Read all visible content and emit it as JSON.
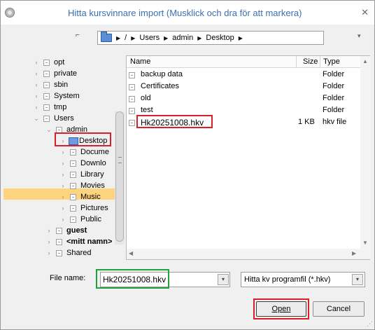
{
  "window": {
    "title": "Hitta kursvinnare import  (Musklick och dra för att markera)"
  },
  "path": {
    "crumbs": [
      "/",
      "Users",
      "admin",
      "Desktop"
    ]
  },
  "tree": {
    "items": [
      {
        "label": "opt"
      },
      {
        "label": "private"
      },
      {
        "label": "sbin"
      },
      {
        "label": "System"
      },
      {
        "label": "tmp"
      },
      {
        "label": "Users"
      },
      {
        "label": "admin"
      },
      {
        "label": "Desktop"
      },
      {
        "label": "Docume"
      },
      {
        "label": "Downlo"
      },
      {
        "label": "Library"
      },
      {
        "label": "Movies"
      },
      {
        "label": "Music"
      },
      {
        "label": "Pictures"
      },
      {
        "label": "Public"
      },
      {
        "label": "guest"
      },
      {
        "label": "<mitt namn>"
      },
      {
        "label": "Shared"
      }
    ]
  },
  "filelist": {
    "columns": {
      "name": "Name",
      "size": "Size",
      "type": "Type"
    },
    "rows": [
      {
        "name": "backup data",
        "size": "",
        "type": "Folder"
      },
      {
        "name": "Certificates",
        "size": "",
        "type": "Folder"
      },
      {
        "name": "old",
        "size": "",
        "type": "Folder"
      },
      {
        "name": "test",
        "size": "",
        "type": "Folder"
      },
      {
        "name": "Hk20251008.hkv",
        "size": "1 KB",
        "type": "hkv file"
      }
    ]
  },
  "filename": {
    "label": "File name:",
    "value": "Hk20251008.hkv"
  },
  "filetype": {
    "value": "Hitta kv programfil (*.hkv)"
  },
  "buttons": {
    "open": "Open",
    "cancel": "Cancel"
  }
}
